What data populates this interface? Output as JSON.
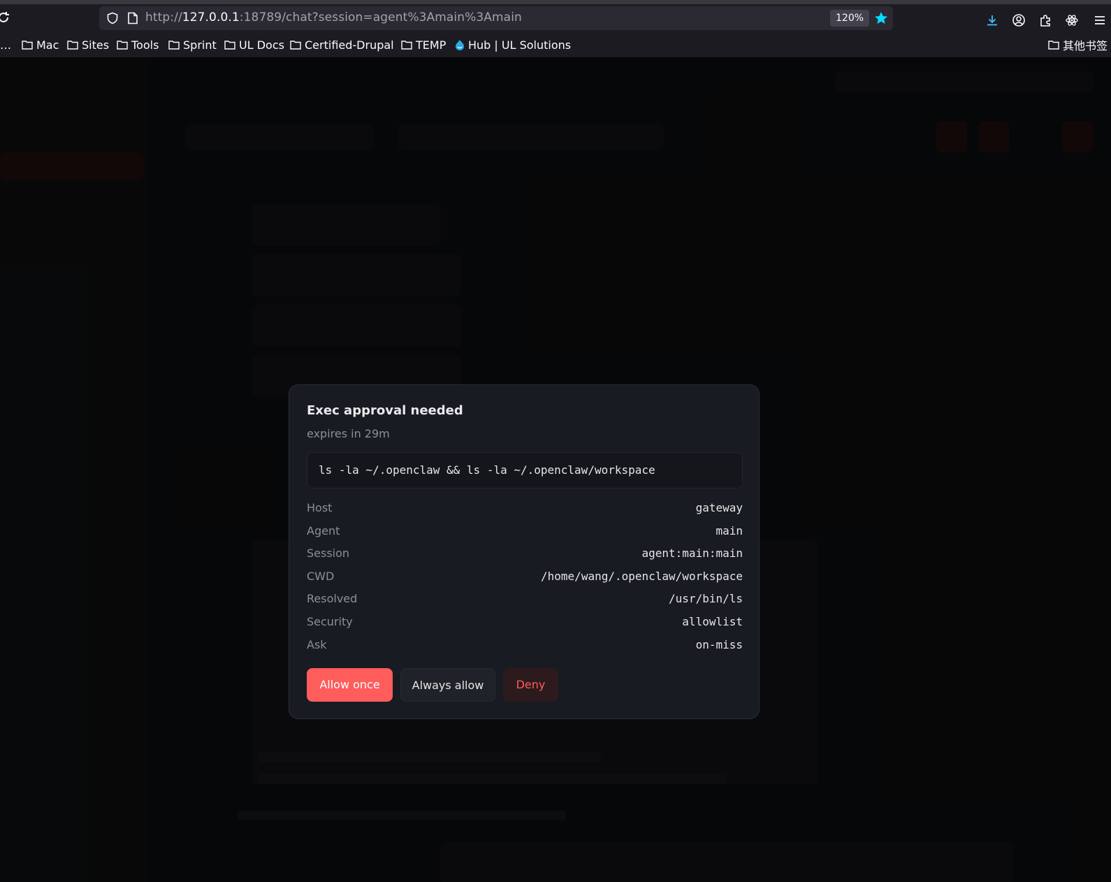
{
  "browser": {
    "url_prefix": "http://",
    "url_host": "127.0.0.1",
    "url_rest": ":18789/chat?session=agent%3Amain%3Amain",
    "zoom": "120%"
  },
  "bookmarks": [
    {
      "label": "…"
    },
    {
      "label": "Mac"
    },
    {
      "label": "Sites"
    },
    {
      "label": "Tools"
    },
    {
      "label": "Sprint"
    },
    {
      "label": "UL Docs"
    },
    {
      "label": "Certified-Drupal"
    },
    {
      "label": "TEMP"
    },
    {
      "label": "Hub | UL Solutions"
    }
  ],
  "other_bookmarks": "其他书签",
  "modal": {
    "title": "Exec approval needed",
    "subtitle": "expires in 29m",
    "command": "ls -la ~/.openclaw && ls -la ~/.openclaw/workspace",
    "details": [
      {
        "key": "Host",
        "value": "gateway"
      },
      {
        "key": "Agent",
        "value": "main"
      },
      {
        "key": "Session",
        "value": "agent:main:main"
      },
      {
        "key": "CWD",
        "value": "/home/wang/.openclaw/workspace"
      },
      {
        "key": "Resolved",
        "value": "/usr/bin/ls"
      },
      {
        "key": "Security",
        "value": "allowlist"
      },
      {
        "key": "Ask",
        "value": "on-miss"
      }
    ],
    "buttons": {
      "allow_once": "Allow once",
      "always_allow": "Always allow",
      "deny": "Deny"
    }
  },
  "colors": {
    "accent": "#ff5c5c",
    "modal_bg": "#181b21",
    "star": "#00ddff"
  }
}
